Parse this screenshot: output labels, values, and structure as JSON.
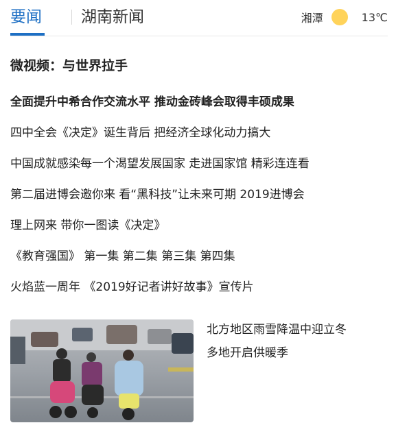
{
  "tabs": [
    {
      "label": "要闻",
      "active": true
    },
    {
      "label": "湖南新闻",
      "active": false
    }
  ],
  "weather": {
    "city": "湘潭",
    "icon": "sun-icon",
    "temperature": "13℃"
  },
  "section": {
    "title": "微视频：与世界拉手"
  },
  "news": {
    "headline": "全面提升中希合作交流水平 推动金砖峰会取得丰硕成果",
    "items": [
      "四中全会《决定》诞生背后 把经济全球化动力搞大",
      "中国成就感染每一个渴望发展国家 走进国家馆 精彩连连看",
      "第二届进博会邀你来 看“黑科技”让未来可期 2019进博会",
      "理上网来 带你一图读《决定》",
      "《教育强国》 第一集 第二集 第三集 第四集",
      "火焰蓝一周年 《2019好记者讲好故事》宣传片"
    ]
  },
  "feature": {
    "line1": "北方地区雨雪降温中迎立冬",
    "line2": "多地开启供暖季"
  },
  "colors": {
    "accent": "#1d6fc4",
    "sun": "#ffd35a",
    "divider": "#e6e6e6"
  }
}
